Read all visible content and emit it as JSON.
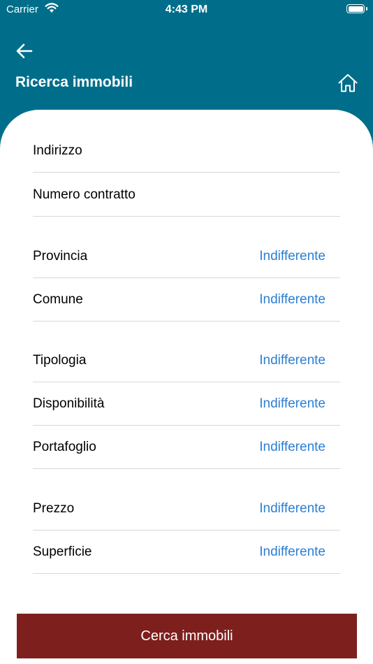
{
  "status_bar": {
    "carrier": "Carrier",
    "time": "4:43 PM"
  },
  "header": {
    "title": "Ricerca immobili",
    "back_icon": "arrow-left-icon",
    "home_icon": "home-icon"
  },
  "form": {
    "text_fields": [
      {
        "label": "Indirizzo"
      },
      {
        "label": "Numero contratto"
      }
    ],
    "location": [
      {
        "label": "Provincia",
        "value": "Indifferente"
      },
      {
        "label": "Comune",
        "value": "Indifferente"
      }
    ],
    "property": [
      {
        "label": "Tipologia",
        "value": "Indifferente"
      },
      {
        "label": "Disponibilità",
        "value": "Indifferente"
      },
      {
        "label": "Portafoglio",
        "value": "Indifferente"
      }
    ],
    "size_price": [
      {
        "label": "Prezzo",
        "value": "Indifferente"
      },
      {
        "label": "Superficie",
        "value": "Indifferente"
      }
    ]
  },
  "search_button": {
    "label": "Cerca immobili"
  },
  "colors": {
    "header_bg": "#006e8a",
    "accent_value": "#2b7fd4",
    "button_bg": "#7d1f1d"
  }
}
